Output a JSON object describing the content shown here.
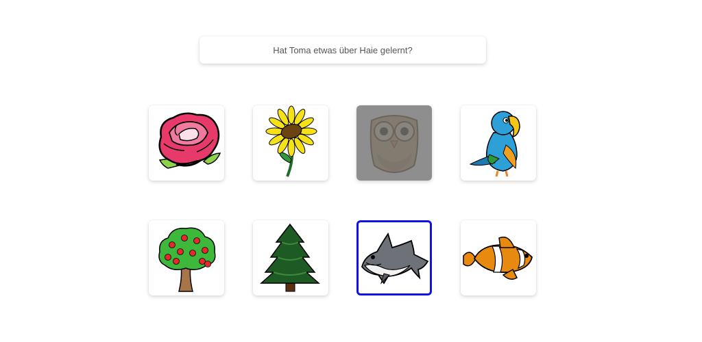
{
  "question": {
    "text": "Hat Toma etwas über Haie gelernt?"
  },
  "cards": [
    {
      "icon": "rose-icon",
      "state": "normal"
    },
    {
      "icon": "sunflower-icon",
      "state": "normal"
    },
    {
      "icon": "owl-icon",
      "state": "dimmed"
    },
    {
      "icon": "parrot-icon",
      "state": "normal"
    },
    {
      "icon": "apple-tree-icon",
      "state": "normal"
    },
    {
      "icon": "fir-tree-icon",
      "state": "normal"
    },
    {
      "icon": "shark-icon",
      "state": "selected"
    },
    {
      "icon": "clownfish-icon",
      "state": "normal"
    }
  ],
  "colors": {
    "selected_border": "#1010e8",
    "dim_overlay": "#6e6e6e"
  }
}
